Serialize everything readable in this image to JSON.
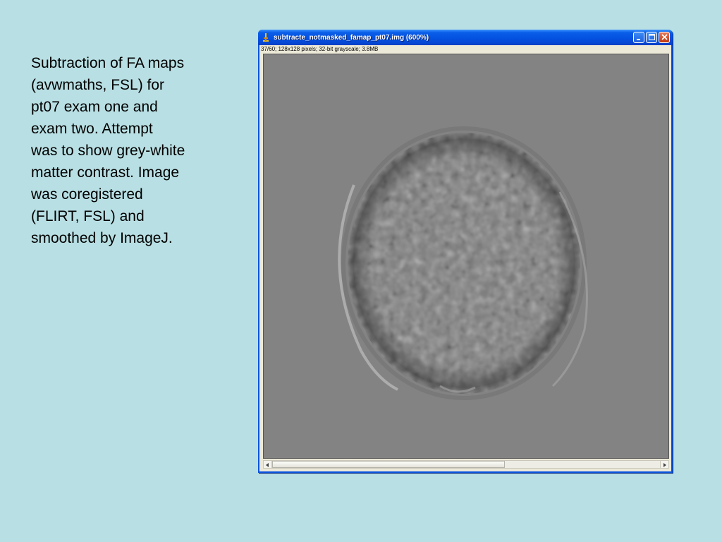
{
  "caption": {
    "text": "Subtraction of FA maps\n(avwmaths, FSL) for\npt07 exam one and\nexam two.  Attempt\nwas to show grey-white\nmatter contrast.  Image\nwas coregistered\n(FLIRT, FSL) and\nsmoothed by ImageJ."
  },
  "window": {
    "title": "subtracte_notmasked_famap_pt07.img (600%)",
    "status": "37/60; 128x128 pixels; 32-bit grayscale; 3.8MB",
    "icon": "microscope-icon",
    "buttons": {
      "minimize": "minimize-icon",
      "maximize": "maximize-icon",
      "close": "close-icon"
    },
    "scrollbar": {
      "position_fraction": 0.6
    }
  },
  "colors": {
    "slide_background": "#b8dfe3",
    "titlebar": "#0553e2",
    "image_background": "#838383"
  }
}
